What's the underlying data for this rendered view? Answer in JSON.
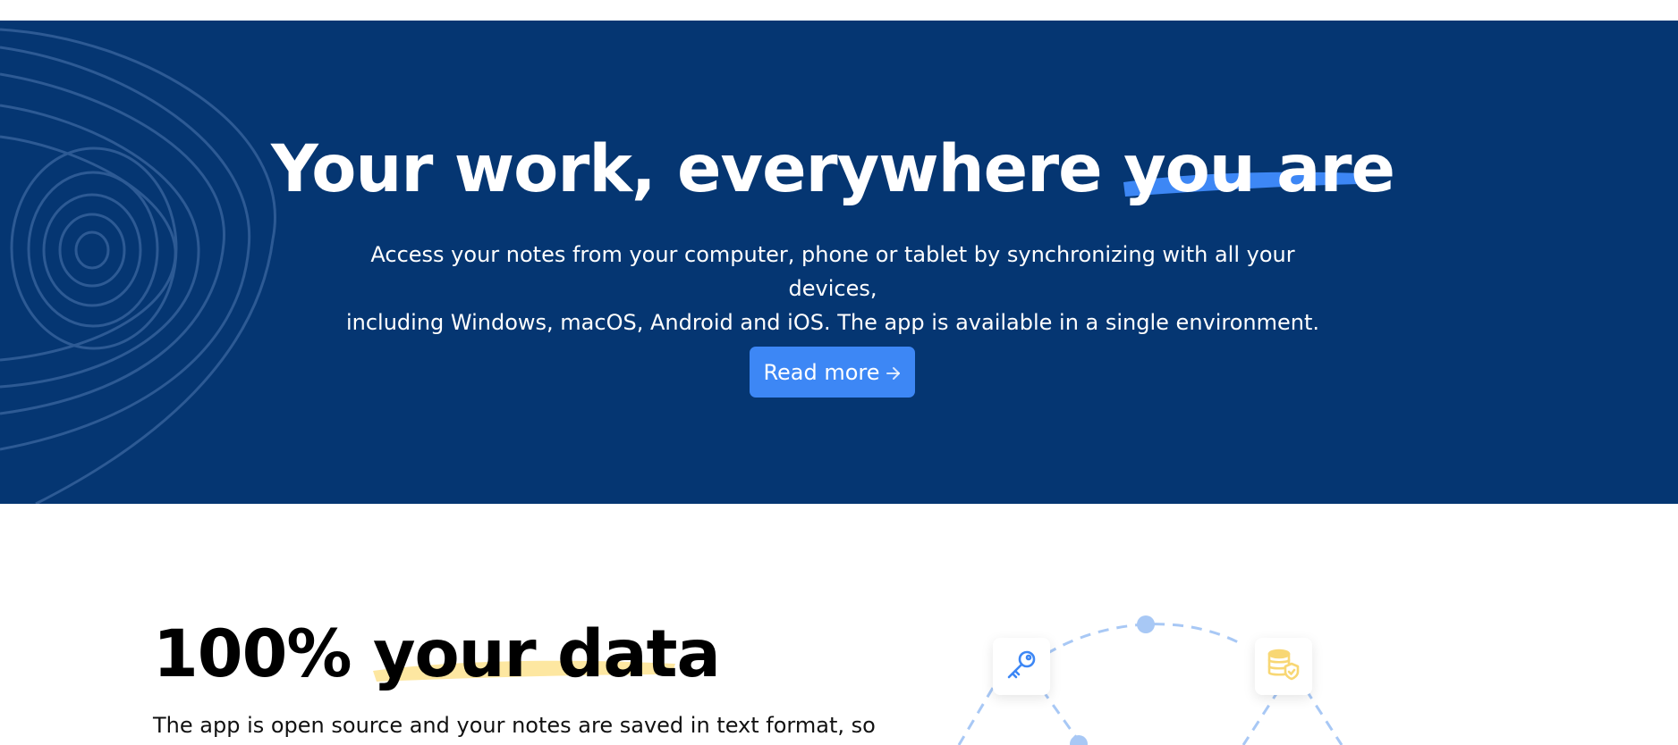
{
  "hero": {
    "title_lead": "Your work, everywhere ",
    "title_highlight": "you are",
    "subtitle_line1": "Access your notes from your computer, phone or tablet by synchronizing with all your devices,",
    "subtitle_line2": "including Windows, macOS, Android and iOS. The app is available in a single environment.",
    "cta_label": "Read more",
    "cta_icon": "arrow-right-icon"
  },
  "data_section": {
    "title_lead": "100% ",
    "title_highlight": "your data",
    "description": "The app is open source and your notes are saved in text format, so",
    "diagram_icons": [
      "key-icon",
      "database-shield-icon"
    ]
  },
  "colors": {
    "hero_bg": "#053672",
    "contour": "#2d5a94",
    "button": "#3d87f5",
    "hero_highlight": "#3d87f5",
    "data_highlight": "#fde7a1",
    "diagram_line": "#a8c8f5",
    "key_icon": "#3d87f5",
    "database_icon": "#f8d774"
  }
}
